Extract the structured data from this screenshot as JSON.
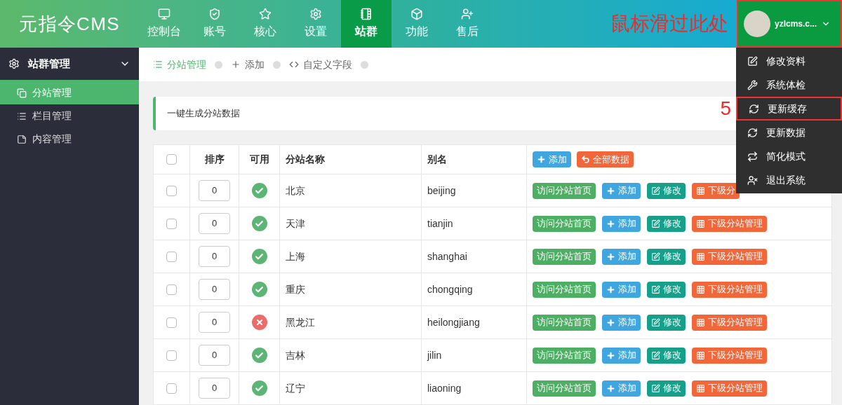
{
  "logo": "元指令CMS",
  "nav": [
    {
      "label": "控制台",
      "kind": "monitor",
      "selected": false
    },
    {
      "label": "账号",
      "kind": "shield",
      "selected": false
    },
    {
      "label": "核心",
      "kind": "star",
      "selected": false
    },
    {
      "label": "设置",
      "kind": "gear",
      "selected": false
    },
    {
      "label": "站群",
      "kind": "notebook",
      "selected": true
    },
    {
      "label": "功能",
      "kind": "box",
      "selected": false
    },
    {
      "label": "售后",
      "kind": "user-plus",
      "selected": false
    }
  ],
  "hover_note": "鼠标滑过此处",
  "user": {
    "name": "yzlcms.c..."
  },
  "user_menu": [
    {
      "label": "修改资料",
      "kind": "edit",
      "highlighted": false
    },
    {
      "label": "系统体检",
      "kind": "wrench",
      "highlighted": false
    },
    {
      "label": "更新缓存",
      "kind": "refresh",
      "highlighted": true,
      "step": "5"
    },
    {
      "label": "更新数据",
      "kind": "refresh",
      "highlighted": false
    },
    {
      "label": "简化模式",
      "kind": "retweet",
      "highlighted": false
    },
    {
      "label": "退出系统",
      "kind": "user-x",
      "highlighted": false
    }
  ],
  "sidebar": {
    "title": "站群管理",
    "items": [
      {
        "label": "分站管理",
        "kind": "copy",
        "selected": true
      },
      {
        "label": "栏目管理",
        "kind": "list",
        "selected": false
      },
      {
        "label": "内容管理",
        "kind": "note",
        "selected": false
      }
    ]
  },
  "breadcrumb": [
    {
      "label": "分站管理",
      "kind": "list",
      "selected": true
    },
    {
      "label": "添加",
      "kind": "plus",
      "selected": false
    },
    {
      "label": "自定义字段",
      "kind": "code",
      "selected": false
    }
  ],
  "notice": "一键生成分站数据",
  "table": {
    "all_checked": false,
    "columns": [
      "排序",
      "可用",
      "分站名称",
      "别名"
    ],
    "header_actions": [
      {
        "label": "添加",
        "kind": "add"
      },
      {
        "label": "全部数据",
        "kind": "all"
      }
    ],
    "rows": [
      {
        "checked": false,
        "order": "0",
        "enabled": true,
        "name": "北京",
        "alias": "beijing",
        "actions": [
          "访问分站首页",
          "添加",
          "修改",
          "下级分"
        ]
      },
      {
        "checked": false,
        "order": "0",
        "enabled": true,
        "name": "天津",
        "alias": "tianjin",
        "actions": [
          "访问分站首页",
          "添加",
          "修改",
          "下级分站管理"
        ]
      },
      {
        "checked": false,
        "order": "0",
        "enabled": true,
        "name": "上海",
        "alias": "shanghai",
        "actions": [
          "访问分站首页",
          "添加",
          "修改",
          "下级分站管理"
        ]
      },
      {
        "checked": false,
        "order": "0",
        "enabled": true,
        "name": "重庆",
        "alias": "chongqing",
        "actions": [
          "访问分站首页",
          "添加",
          "修改",
          "下级分站管理"
        ]
      },
      {
        "checked": false,
        "order": "0",
        "enabled": false,
        "name": "黑龙江",
        "alias": "heilongjiang",
        "actions": [
          "访问分站首页",
          "添加",
          "修改",
          "下级分站管理"
        ]
      },
      {
        "checked": false,
        "order": "0",
        "enabled": true,
        "name": "吉林",
        "alias": "jilin",
        "actions": [
          "访问分站首页",
          "添加",
          "修改",
          "下级分站管理"
        ]
      },
      {
        "checked": false,
        "order": "0",
        "enabled": true,
        "name": "辽宁",
        "alias": "liaoning",
        "actions": [
          "访问分站首页",
          "添加",
          "修改",
          "下级分站管理"
        ]
      }
    ]
  }
}
